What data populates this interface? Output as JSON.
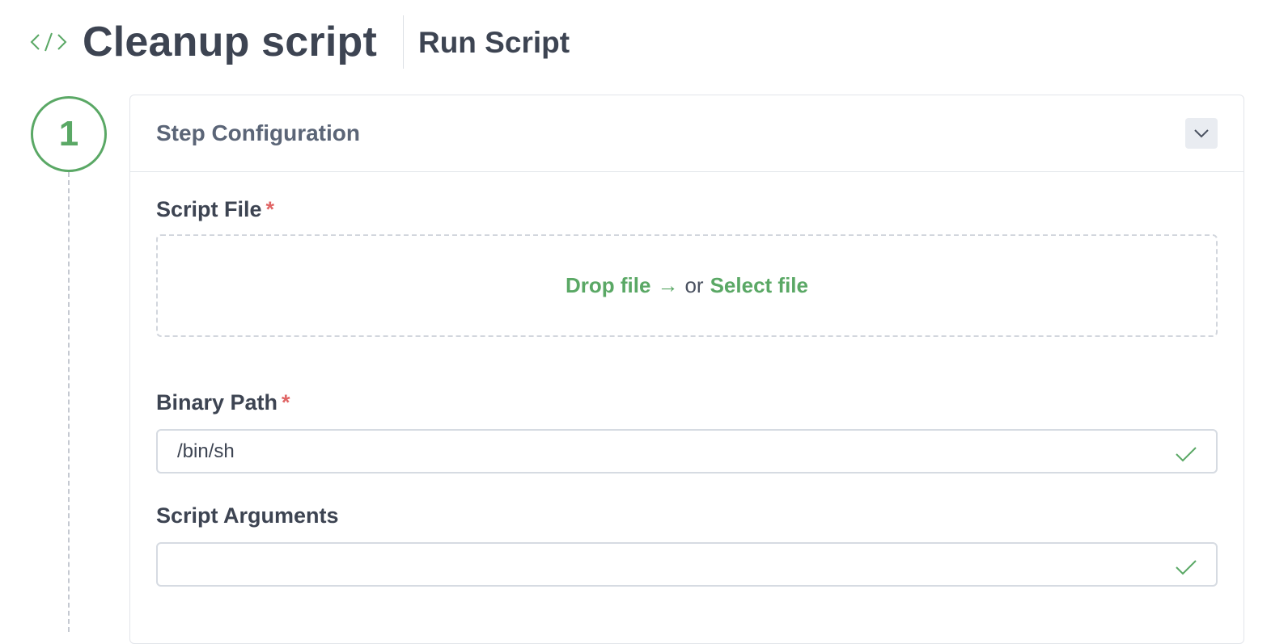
{
  "header": {
    "icon": "code-icon",
    "title": "Cleanup script",
    "subtitle": "Run Script"
  },
  "step": {
    "number": "1"
  },
  "card": {
    "title": "Step Configuration",
    "collapse_icon": "chevron-down-icon"
  },
  "fields": {
    "script_file": {
      "label": "Script File",
      "required_mark": "*",
      "drop_text": "Drop file",
      "arrow": "→",
      "or_text": "or",
      "select_text": "Select file"
    },
    "binary_path": {
      "label": "Binary Path",
      "required_mark": "*",
      "value": "/bin/sh",
      "status_icon": "check-icon"
    },
    "script_arguments": {
      "label": "Script Arguments",
      "value": "",
      "status_icon": "check-icon"
    }
  },
  "colors": {
    "accent": "#5aa865",
    "required": "#e06464",
    "text": "#3d4452",
    "muted_title": "#5b6577"
  }
}
